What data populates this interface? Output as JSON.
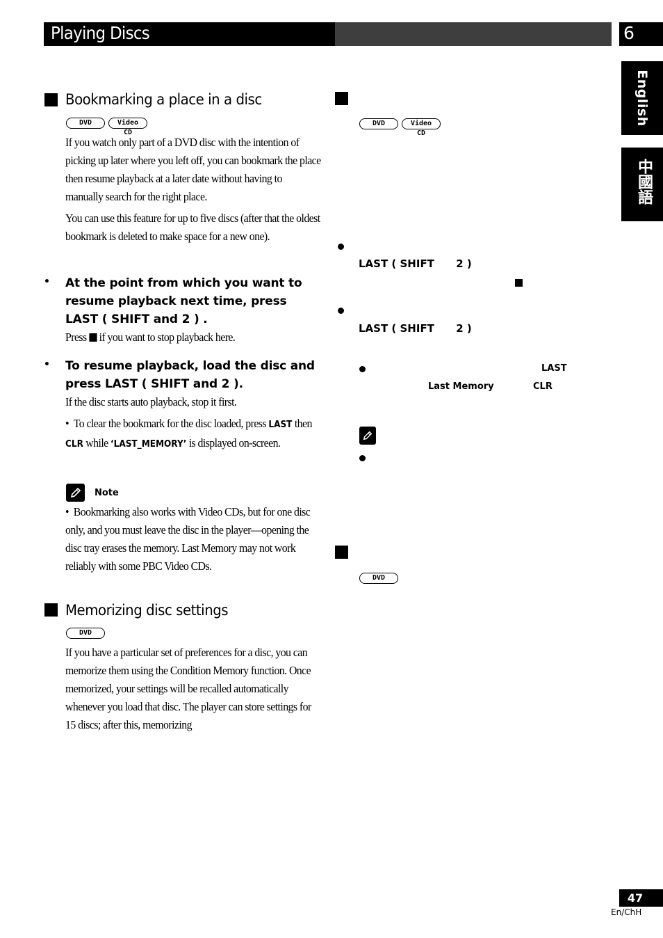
{
  "header": {
    "title": "Playing Discs",
    "chapter_number": "6"
  },
  "side_tabs": {
    "english": "English",
    "chinese": "中國語"
  },
  "left_column": {
    "bookmark_section": {
      "title": "Bookmarking a place in a disc",
      "badges": [
        "DVD",
        "Video CD"
      ],
      "intro_paragraphs": [
        "If you watch only part of a DVD disc with the intention of picking up later where you left off, you can bookmark the place then resume playback at a later date without having to manually search for the right place.",
        "You can use this feature for up to five discs (after that the oldest bookmark is deleted to make space for a new one)."
      ],
      "steps": [
        {
          "instruction": "At the point from which you want to resume playback next time, press LAST ( SHIFT and 2 ) .",
          "detail_prefix": "Press",
          "detail_suffix": "if you want to stop playback here."
        },
        {
          "instruction": "To resume playback, load the disc and press LAST ( SHIFT and 2 ).",
          "detail": "If the disc starts auto playback, stop it first.",
          "sub_bullet": {
            "text_1": "To clear the bookmark for the disc loaded, press",
            "key_1": "LAST",
            "text_2": "then",
            "key_2": "CLR",
            "text_3": "while",
            "key_3": "‘LAST_MEMORY’",
            "text_4": "is displayed on-screen."
          }
        }
      ],
      "note": {
        "label": "Note",
        "text": "Bookmarking also works with Video CDs, but for one disc only, and you must leave the disc in the player—opening the disc tray erases the memory. Last Memory may not work reliably with some PBC Video CDs."
      }
    },
    "memorize_section": {
      "title": "Memorizing disc settings",
      "badges": [
        "DVD"
      ],
      "paragraph": "If you have a particular set of preferences for a disc, you can memorize them using the Condition Memory function. Once memorized, your settings will be recalled automatically whenever you load that disc. The player can store settings for 15 discs; after this, memorizing"
    }
  },
  "right_column": {
    "section1": {
      "badges": [
        "DVD",
        "Video CD"
      ],
      "step1_keys": "LAST ( SHIFT      2 )",
      "step2_keys": "LAST ( SHIFT      2 )",
      "sub_key_1": "LAST",
      "sub_key_2": "Last Memory",
      "sub_key_3": "CLR"
    },
    "section2": {
      "badges": [
        "DVD"
      ]
    }
  },
  "footer": {
    "page_number": "47",
    "language_code": "En/ChH"
  }
}
